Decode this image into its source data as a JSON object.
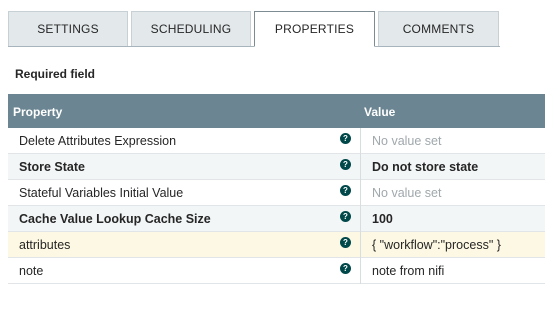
{
  "tabs": [
    {
      "label": "SETTINGS"
    },
    {
      "label": "SCHEDULING"
    },
    {
      "label": "PROPERTIES"
    },
    {
      "label": "COMMENTS"
    }
  ],
  "required_field_label": "Required field",
  "grid": {
    "columns": {
      "property": "Property",
      "value": "Value"
    },
    "rows": [
      {
        "name": "Delete Attributes Expression",
        "value": "No value set"
      },
      {
        "name": "Store State",
        "value": "Do not store state"
      },
      {
        "name": "Stateful Variables Initial Value",
        "value": "No value set"
      },
      {
        "name": "Cache Value Lookup Cache Size",
        "value": "100"
      },
      {
        "name": "attributes",
        "value": "{ \"workflow\":\"process\" }"
      },
      {
        "name": "note",
        "value": "note from nifi"
      }
    ],
    "help_glyph": "?"
  }
}
